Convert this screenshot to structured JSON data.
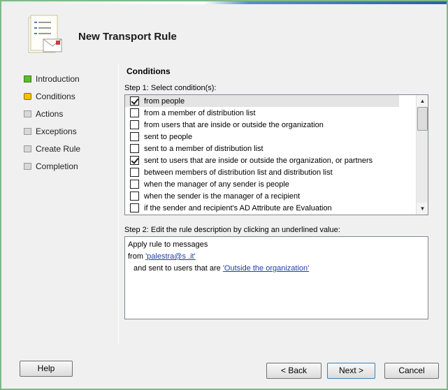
{
  "window": {
    "title": "New Transport Rule"
  },
  "nav": {
    "items": [
      {
        "label": "Introduction",
        "state": "done"
      },
      {
        "label": "Conditions",
        "state": "current"
      },
      {
        "label": "Actions",
        "state": "pending"
      },
      {
        "label": "Exceptions",
        "state": "pending"
      },
      {
        "label": "Create Rule",
        "state": "pending"
      },
      {
        "label": "Completion",
        "state": "pending"
      }
    ]
  },
  "main": {
    "section_title": "Conditions",
    "step1_label": "Step 1: Select condition(s):",
    "conditions": [
      {
        "label": "from people",
        "checked": true
      },
      {
        "label": "from a member of distribution list",
        "checked": false
      },
      {
        "label": "from users that are inside or outside the organization",
        "checked": false
      },
      {
        "label": "sent to people",
        "checked": false
      },
      {
        "label": "sent to a member of distribution list",
        "checked": false
      },
      {
        "label": "sent to users that are inside or outside the organization, or partners",
        "checked": true
      },
      {
        "label": "between members of distribution list and distribution list",
        "checked": false
      },
      {
        "label": "when the manager of any sender is people",
        "checked": false
      },
      {
        "label": "when the sender is the manager of a recipient",
        "checked": false
      },
      {
        "label": "if the sender and recipient's AD Attribute are Evaluation",
        "checked": false
      }
    ],
    "step2_label": "Step 2: Edit the rule description by clicking an underlined value:",
    "description": {
      "line1": "Apply rule to messages",
      "from_prefix": "from ",
      "from_link": "'palestra@s              .it'",
      "sent_prefix": "and sent to users that are ",
      "sent_link": "'Outside the organization'"
    }
  },
  "footer": {
    "help": "Help",
    "back": "< Back",
    "next": "Next >",
    "cancel": "Cancel"
  },
  "colors": {
    "done": "#5dbb2a",
    "current": "#f2c200",
    "link": "#1f3fa0"
  }
}
